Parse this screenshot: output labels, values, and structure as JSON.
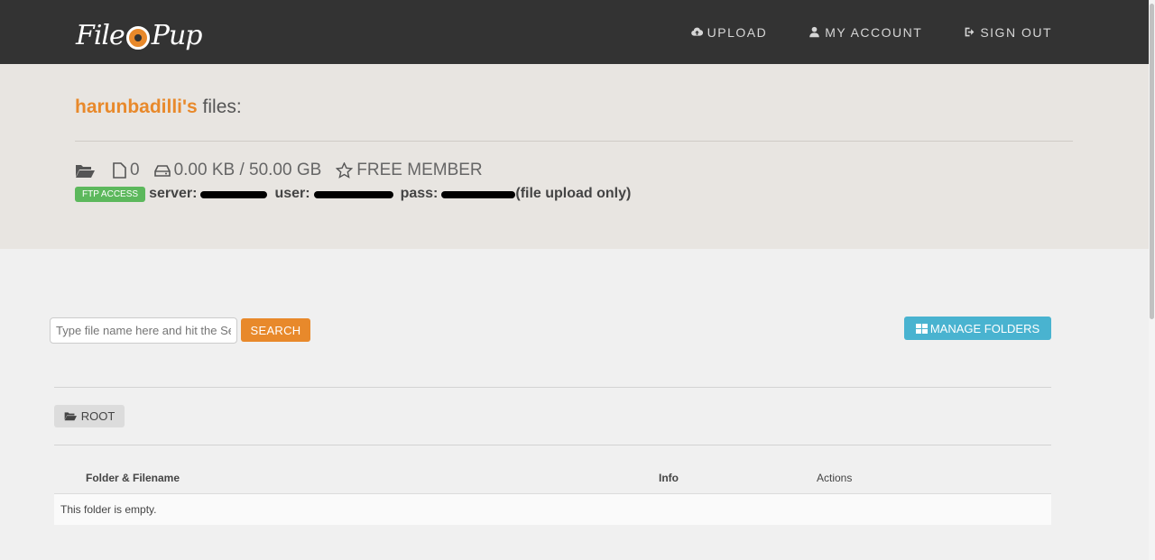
{
  "header": {
    "logo_text_left": "File",
    "logo_text_right": "Pup",
    "nav": [
      {
        "label": "UPLOAD",
        "icon": "cloud-upload-icon"
      },
      {
        "label": "MY ACCOUNT",
        "icon": "user-icon"
      },
      {
        "label": "SIGN OUT",
        "icon": "sign-out-icon"
      }
    ]
  },
  "profile": {
    "username": "harunbadilli's",
    "title_suffix": " files:",
    "file_count": "0",
    "storage": "0.00 KB / 50.00 GB",
    "membership": "FREE MEMBER",
    "ftp": {
      "badge": "FTP ACCESS",
      "server_label": "server:",
      "user_label": "user:",
      "pass_label": "pass:",
      "note": "(file upload only)"
    }
  },
  "search": {
    "placeholder": "Type file name here and hit the Search",
    "button_label": "SEARCH"
  },
  "manage_folders_label": "MANAGE FOLDERS",
  "breadcrumb_root": "ROOT",
  "table": {
    "columns": [
      "Folder & Filename",
      "Info",
      "Actions"
    ],
    "empty_message": "This folder is empty."
  },
  "colors": {
    "accent": "#e8892b",
    "header_bg": "#333333",
    "info_button": "#49b3d0",
    "ftp_badge": "#5cb85c"
  }
}
